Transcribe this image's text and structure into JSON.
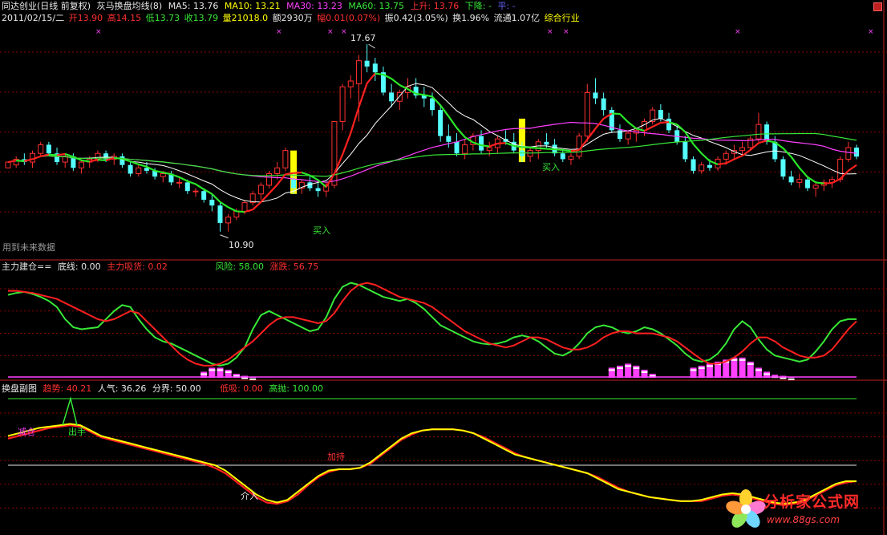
{
  "header": {
    "line1": {
      "name": "同达创业(日线 前复权)",
      "indicator": "灰马换盘均线(8)",
      "ma5": "MA5: 13.76",
      "ma10": "MA10: 13.21",
      "ma30": "MA30: 13.23",
      "ma60": "MA60: 13.75",
      "up": "上升: 13.76",
      "down": "下降: -",
      "flat": "平: -"
    },
    "line2": {
      "date": "2011/02/15/二",
      "open": "开13.90",
      "high": "高14.15",
      "low": "低13.73",
      "close": "收13.79",
      "volume": "量21018.0",
      "amount": "额2930万",
      "change": "幅0.01(0.07%)",
      "amplitude": "振0.42(3.05%)",
      "turnover": "换1.96%",
      "float": "流通1.07亿",
      "sector": "综合行业"
    }
  },
  "main_labels": {
    "peak": "17.67",
    "trough": "10.90",
    "buy1": "买入",
    "buy2": "买入",
    "future": "用到未来数据"
  },
  "ind1": {
    "title": "主力建仓==",
    "base": "底线: 0.00",
    "absorb": "主力吸货: 0.02",
    "risk": "风险: 58.00",
    "rise": "涨跌: 56.75"
  },
  "ind2": {
    "title": "换盘副图",
    "trend": "趋势: 40.21",
    "pop": "人气: 36.26",
    "bound": "分界: 50.00",
    "low": "低吸: 0.00",
    "high": "高抛: 100.00",
    "cut": "减仓",
    "sell": "出手",
    "enter": "介入",
    "hold": "加持"
  },
  "watermark": {
    "title": "分析家公式网",
    "url": "www.88gs.com"
  },
  "colors": {
    "up_candle": "#ff3030",
    "down_candle": "#54ffff",
    "ma5": "#ffffff",
    "ma10": "#ffff00",
    "ma30": "#ff40ff",
    "ma60": "#38e838",
    "buy_bar": "#ffff00",
    "grid": "#8b0000"
  },
  "chart_data": {
    "type": "candlestick",
    "candles": [
      [
        13.4,
        13.6,
        13.5,
        13.6
      ],
      [
        13.5,
        13.8,
        13.4,
        13.7
      ],
      [
        13.7,
        13.9,
        13.5,
        13.6
      ],
      [
        13.6,
        14.0,
        13.4,
        13.9
      ],
      [
        13.9,
        14.3,
        13.8,
        14.2
      ],
      [
        14.2,
        14.3,
        13.8,
        13.9
      ],
      [
        13.9,
        14.1,
        13.5,
        13.6
      ],
      [
        13.6,
        13.9,
        13.4,
        13.8
      ],
      [
        13.8,
        13.9,
        13.3,
        13.4
      ],
      [
        13.4,
        13.7,
        13.2,
        13.6
      ],
      [
        13.6,
        13.8,
        13.4,
        13.7
      ],
      [
        13.7,
        14.0,
        13.6,
        13.9
      ],
      [
        13.9,
        14.0,
        13.6,
        13.7
      ],
      [
        13.7,
        13.9,
        13.5,
        13.8
      ],
      [
        13.8,
        13.9,
        13.4,
        13.5
      ],
      [
        13.5,
        13.6,
        13.1,
        13.2
      ],
      [
        13.2,
        13.5,
        13.1,
        13.4
      ],
      [
        13.4,
        13.6,
        13.2,
        13.3
      ],
      [
        13.3,
        13.4,
        13.0,
        13.1
      ],
      [
        13.1,
        13.3,
        12.9,
        13.2
      ],
      [
        13.2,
        13.3,
        12.8,
        12.9
      ],
      [
        12.9,
        13.1,
        12.7,
        12.9
      ],
      [
        12.9,
        13.0,
        12.5,
        12.6
      ],
      [
        12.6,
        12.7,
        12.4,
        12.6
      ],
      [
        12.6,
        12.7,
        12.2,
        12.3
      ],
      [
        12.3,
        12.5,
        11.9,
        12.1
      ],
      [
        12.1,
        12.2,
        11.2,
        11.5
      ],
      [
        11.5,
        11.8,
        11.2,
        11.7
      ],
      [
        11.7,
        12.0,
        11.6,
        11.9
      ],
      [
        11.9,
        12.3,
        11.8,
        12.2
      ],
      [
        12.2,
        12.6,
        12.1,
        12.5
      ],
      [
        12.5,
        12.9,
        12.3,
        12.8
      ],
      [
        12.8,
        13.3,
        12.7,
        13.2
      ],
      [
        13.2,
        13.6,
        13.0,
        13.4
      ],
      [
        13.4,
        14.1,
        13.3,
        14.0
      ],
      [
        13.0,
        13.2,
        12.5,
        12.7
      ],
      [
        12.7,
        13.0,
        12.5,
        12.9
      ],
      [
        12.9,
        13.1,
        12.6,
        12.7
      ],
      [
        12.7,
        12.9,
        12.4,
        12.6
      ],
      [
        12.6,
        12.9,
        12.4,
        12.8
      ],
      [
        12.8,
        15.0,
        12.7,
        15.0
      ],
      [
        15.0,
        16.3,
        14.7,
        16.2
      ],
      [
        16.2,
        16.6,
        15.8,
        16.4
      ],
      [
        16.3,
        17.3,
        15.0,
        17.1
      ],
      [
        17.1,
        17.67,
        16.7,
        16.9
      ],
      [
        17.0,
        17.2,
        16.4,
        16.7
      ],
      [
        16.7,
        16.9,
        15.9,
        16.0
      ],
      [
        16.0,
        16.3,
        15.5,
        15.7
      ],
      [
        15.7,
        16.1,
        15.4,
        16.0
      ],
      [
        16.0,
        16.5,
        15.8,
        16.2
      ],
      [
        16.2,
        16.5,
        15.8,
        15.9
      ],
      [
        15.9,
        16.2,
        15.5,
        15.8
      ],
      [
        15.8,
        16.0,
        15.2,
        15.4
      ],
      [
        15.4,
        15.6,
        14.3,
        14.5
      ],
      [
        14.5,
        14.9,
        14.1,
        14.3
      ],
      [
        14.3,
        14.6,
        13.8,
        13.9
      ],
      [
        13.9,
        14.4,
        13.7,
        14.2
      ],
      [
        14.2,
        14.6,
        14.0,
        14.5
      ],
      [
        14.5,
        14.7,
        13.9,
        14.0
      ],
      [
        14.0,
        14.3,
        13.8,
        14.1
      ],
      [
        14.1,
        14.5,
        13.9,
        14.4
      ],
      [
        14.4,
        14.7,
        14.2,
        14.3
      ],
      [
        14.3,
        14.6,
        13.9,
        14.0
      ],
      [
        14.0,
        14.3,
        13.6,
        13.8
      ],
      [
        13.8,
        14.1,
        13.6,
        14.0
      ],
      [
        14.0,
        14.4,
        13.7,
        14.3
      ],
      [
        14.3,
        14.6,
        14.1,
        14.2
      ],
      [
        14.2,
        14.4,
        13.8,
        13.9
      ],
      [
        13.9,
        14.0,
        13.6,
        13.7
      ],
      [
        13.7,
        13.9,
        13.5,
        13.8
      ],
      [
        13.8,
        14.6,
        13.7,
        14.5
      ],
      [
        14.5,
        16.3,
        14.3,
        16.0
      ],
      [
        16.0,
        16.5,
        15.6,
        15.8
      ],
      [
        15.8,
        16.0,
        15.2,
        15.4
      ],
      [
        15.4,
        15.5,
        14.6,
        14.7
      ],
      [
        14.7,
        14.9,
        14.3,
        14.4
      ],
      [
        14.4,
        14.7,
        14.2,
        14.6
      ],
      [
        14.6,
        14.8,
        14.3,
        14.7
      ],
      [
        14.7,
        15.1,
        14.5,
        15.0
      ],
      [
        15.0,
        15.5,
        14.9,
        15.4
      ],
      [
        15.4,
        15.6,
        15.0,
        15.1
      ],
      [
        15.1,
        15.3,
        14.6,
        14.7
      ],
      [
        14.7,
        14.9,
        14.2,
        14.3
      ],
      [
        14.3,
        14.5,
        13.6,
        13.7
      ],
      [
        13.7,
        13.8,
        13.2,
        13.3
      ],
      [
        13.3,
        13.6,
        13.2,
        13.5
      ],
      [
        13.5,
        13.7,
        13.3,
        13.4
      ],
      [
        13.4,
        13.8,
        13.3,
        13.7
      ],
      [
        13.7,
        14.0,
        13.5,
        13.9
      ],
      [
        13.9,
        14.2,
        13.7,
        14.0
      ],
      [
        14.0,
        14.3,
        13.8,
        14.1
      ],
      [
        14.1,
        14.5,
        14.0,
        14.4
      ],
      [
        14.4,
        15.3,
        14.3,
        14.9
      ],
      [
        14.9,
        15.0,
        14.2,
        14.3
      ],
      [
        14.3,
        14.5,
        13.6,
        13.7
      ],
      [
        13.7,
        13.8,
        13.0,
        13.1
      ],
      [
        13.1,
        13.3,
        12.8,
        12.9
      ],
      [
        12.9,
        13.2,
        12.7,
        13.0
      ],
      [
        13.0,
        13.1,
        12.6,
        12.7
      ],
      [
        12.7,
        12.9,
        12.4,
        12.8
      ],
      [
        12.8,
        13.0,
        12.6,
        12.9
      ],
      [
        12.9,
        13.1,
        12.7,
        13.0
      ],
      [
        13.0,
        13.8,
        12.9,
        13.7
      ],
      [
        13.7,
        14.3,
        13.6,
        14.1
      ],
      [
        14.1,
        14.2,
        13.7,
        13.79
      ]
    ],
    "ylim": [
      10.5,
      18.2
    ],
    "peak": 17.67,
    "trough": 10.9,
    "buy_bars": [
      35,
      63
    ],
    "ind1": {
      "ylim": [
        0,
        100
      ],
      "green": [
        82,
        84,
        85,
        83,
        80,
        76,
        70,
        58,
        50,
        48,
        49,
        50,
        58,
        66,
        72,
        70,
        58,
        48,
        40,
        36,
        34,
        30,
        26,
        22,
        18,
        14,
        12,
        14,
        20,
        30,
        48,
        62,
        66,
        62,
        58,
        54,
        50,
        46,
        48,
        60,
        78,
        90,
        94,
        92,
        88,
        84,
        80,
        78,
        76,
        78,
        74,
        68,
        60,
        52,
        48,
        44,
        40,
        36,
        34,
        33,
        34,
        36,
        40,
        42,
        40,
        36,
        30,
        24,
        22,
        26,
        34,
        44,
        50,
        52,
        50,
        46,
        44,
        46,
        50,
        48,
        44,
        38,
        32,
        24,
        18,
        16,
        18,
        24,
        34,
        48,
        56,
        50,
        38,
        28,
        22,
        20,
        18,
        16,
        18,
        26,
        36,
        48,
        56,
        58,
        58
      ],
      "red": [
        86,
        86,
        85,
        84,
        82,
        80,
        78,
        74,
        70,
        66,
        62,
        58,
        56,
        58,
        62,
        66,
        64,
        56,
        48,
        40,
        32,
        24,
        18,
        14,
        12,
        12,
        14,
        18,
        24,
        30,
        36,
        44,
        52,
        58,
        60,
        60,
        58,
        56,
        54,
        56,
        64,
        76,
        86,
        92,
        94,
        92,
        88,
        84,
        80,
        78,
        76,
        74,
        70,
        64,
        58,
        52,
        46,
        42,
        38,
        34,
        32,
        30,
        32,
        36,
        40,
        40,
        38,
        34,
        30,
        28,
        28,
        30,
        34,
        40,
        44,
        46,
        46,
        44,
        44,
        44,
        42,
        40,
        36,
        30,
        24,
        18,
        14,
        14,
        16,
        20,
        26,
        34,
        40,
        40,
        36,
        30,
        26,
        22,
        20,
        20,
        22,
        28,
        38,
        48,
        56
      ],
      "bars": [
        0,
        0,
        0,
        0,
        0,
        0,
        0,
        0,
        0,
        0,
        0,
        0,
        0,
        0,
        0,
        0,
        0,
        0,
        0,
        0,
        0,
        0,
        0,
        0,
        6,
        10,
        10,
        8,
        4,
        2,
        1,
        0,
        0,
        0,
        0,
        0,
        0,
        0,
        0,
        0,
        0,
        0,
        0,
        0,
        0,
        0,
        0,
        0,
        0,
        0,
        0,
        0,
        0,
        0,
        0,
        0,
        0,
        0,
        0,
        0,
        0,
        0,
        0,
        0,
        0,
        0,
        0,
        0,
        0,
        0,
        0,
        0,
        0,
        0,
        10,
        12,
        14,
        12,
        8,
        4,
        0,
        0,
        0,
        0,
        10,
        12,
        14,
        16,
        18,
        20,
        20,
        16,
        10,
        6,
        3,
        2,
        1,
        0,
        0,
        0,
        0,
        0,
        0,
        0,
        0
      ]
    },
    "ind2": {
      "ylim": [
        0,
        100
      ],
      "bound": 50,
      "high": 100,
      "low": 0,
      "yellow": [
        72,
        74,
        76,
        78,
        79,
        80,
        81,
        80,
        76,
        72,
        70,
        68,
        66,
        64,
        62,
        60,
        58,
        56,
        54,
        52,
        50,
        46,
        40,
        34,
        28,
        24,
        22,
        24,
        30,
        36,
        42,
        46,
        47,
        47,
        48,
        52,
        58,
        64,
        70,
        74,
        76,
        77,
        77,
        77,
        76,
        74,
        70,
        66,
        62,
        58,
        56,
        54,
        52,
        50,
        48,
        46,
        44,
        40,
        36,
        32,
        30,
        28,
        26,
        25,
        24,
        23,
        23,
        24,
        26,
        28,
        29,
        28,
        26,
        24,
        22,
        21,
        22,
        24,
        28,
        32,
        36,
        38,
        38
      ],
      "red": [
        70,
        72,
        74,
        76,
        78,
        79,
        80,
        79,
        75,
        71,
        69,
        67,
        65,
        63,
        61,
        59,
        57,
        55,
        53,
        51,
        48,
        44,
        38,
        32,
        26,
        22,
        21,
        23,
        28,
        35,
        41,
        45,
        47,
        47,
        48,
        51,
        57,
        63,
        69,
        73,
        76,
        77,
        77,
        77,
        76,
        74,
        71,
        67,
        63,
        59,
        56,
        54,
        52,
        50,
        48,
        46,
        44,
        41,
        37,
        33,
        30,
        28,
        26,
        25,
        24,
        23,
        23,
        23,
        25,
        27,
        28,
        27,
        25,
        23,
        21,
        20,
        21,
        23,
        27,
        31,
        35,
        37,
        38
      ]
    }
  }
}
